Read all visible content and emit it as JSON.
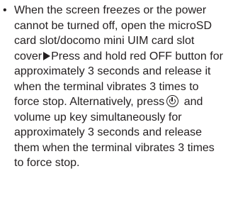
{
  "note": {
    "bullet": "•",
    "lines": [
      "When the screen freezes or the power",
      "cannot be turned off, open the microSD",
      "card slot/docomo mini UIM card slot",
      "Press and hold red OFF button for",
      "approximately 3 seconds and release it",
      "when the terminal vibrates 3 times to",
      "force stop. Alternatively, press",
      "and",
      "volume up key simultaneously for",
      "approximately 3 seconds and release",
      "them when the terminal vibrates 3 times",
      "to force stop."
    ],
    "line4_prefix": "cover",
    "arrow_icon": "right-triangle-icon",
    "power_icon": "power-key-icon",
    "text_color": "#231f20"
  }
}
